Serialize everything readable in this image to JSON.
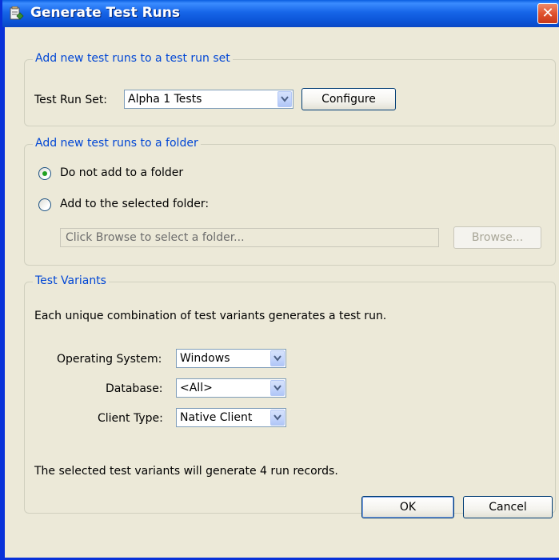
{
  "window": {
    "title": "Generate Test Runs",
    "close_glyph": "✕"
  },
  "test_run_set_group": {
    "legend": "Add new test runs to a test run set",
    "label": "Test Run Set:",
    "selected": "Alpha 1 Tests",
    "configure_label": "Configure"
  },
  "folder_group": {
    "legend": "Add new test runs to a folder",
    "option_none": "Do not add to a folder",
    "option_selected": "Add to the selected folder:",
    "folder_placeholder": "Click Browse to select a folder...",
    "browse_label": "Browse...",
    "selected_option": "none"
  },
  "variants_group": {
    "legend": "Test Variants",
    "description": "Each unique combination of test variants generates a test run.",
    "os_label": "Operating System:",
    "os_value": "Windows",
    "db_label": "Database:",
    "db_value": "<All>",
    "client_label": "Client Type:",
    "client_value": "Native Client",
    "summary": "The selected test variants will generate 4 run records."
  },
  "footer": {
    "ok_label": "OK",
    "cancel_label": "Cancel"
  },
  "icons": {
    "app": "test-runs-icon",
    "close": "close-icon",
    "dropdown": "chevron-down-icon"
  },
  "colors": {
    "titlebar": "#0b53d6",
    "legend_text": "#0046d5",
    "dialog_bg": "#ece9d8",
    "close_button": "#e0522d"
  }
}
